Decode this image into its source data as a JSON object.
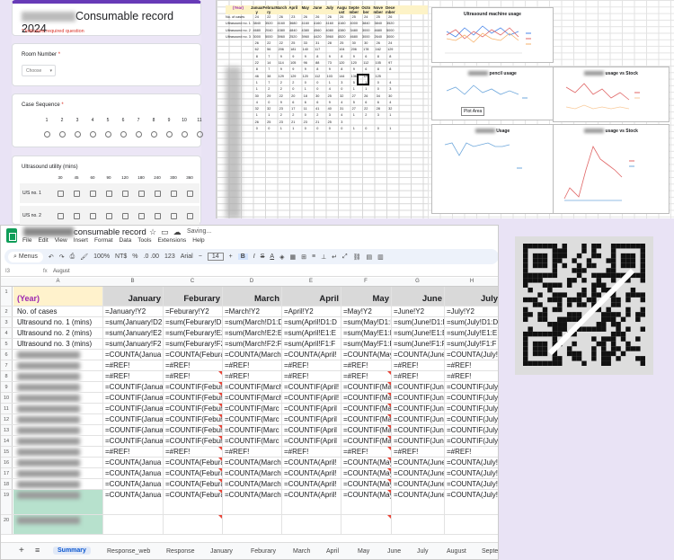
{
  "form": {
    "title_suffix": "Consumable record 2024",
    "required_note": "* Indicates required question",
    "room_label": "Room Number",
    "room_placeholder": "Choose",
    "case_label": "Case Sequence",
    "case_scale": [
      "1",
      "2",
      "3",
      "4",
      "5",
      "6",
      "7",
      "8",
      "9",
      "10",
      "11"
    ],
    "us_label": "Ultrasound utility (mins)",
    "us_columns": [
      "30",
      "45",
      "60",
      "90",
      "120",
      "180",
      "240",
      "300",
      "360"
    ],
    "us_rows": [
      "U/S no. 1",
      "U/S no. 2"
    ]
  },
  "mini_sheet": {
    "year": "(Year)",
    "months": [
      "Januar y",
      "Februa ry",
      "March",
      "April",
      "May",
      "June",
      "July",
      "Augu ust",
      "Septe mber",
      "Octo ber",
      "Nove mber",
      "Dece mber"
    ],
    "rows": [
      {
        "label": "No. of cases",
        "vals": [
          "24",
          "22",
          "26",
          "23",
          "26",
          "26",
          "26",
          "26",
          "25",
          "24",
          "25",
          "26"
        ]
      },
      {
        "label": "Ultrasound no. 1 (mins)",
        "vals": [
          "3840",
          "3520",
          "4160",
          "3680",
          "4160",
          "4160",
          "4160",
          "4160",
          "4000",
          "3840",
          "3840",
          "3520"
        ]
      },
      {
        "label": "Ultrasound no. 2 (mins)",
        "vals": [
          "4680",
          "2040",
          "4380",
          "4840",
          "4380",
          "4560",
          "4080",
          "4380",
          "3480",
          "3000",
          "4680",
          "5000"
        ]
      },
      {
        "label": "Ultrasound no. 3 (mins)",
        "vals": [
          "3000",
          "5000",
          "3960",
          "2520",
          "3960",
          "4420",
          "3960",
          "4520",
          "4680",
          "3000",
          "2640",
          "3000"
        ]
      },
      {
        "label": "",
        "vals": [
          "26",
          "22",
          "22",
          "25",
          "33",
          "31",
          "28",
          "25",
          "30",
          "30",
          "26",
          "24"
        ]
      },
      {
        "label": "",
        "vals": [
          "62",
          "56",
          "206",
          "181",
          "140",
          "117",
          "",
          "104",
          "206",
          "178",
          "162",
          "129"
        ]
      },
      {
        "label": "",
        "vals": [
          "8",
          "7",
          "9",
          "9",
          "9",
          "8",
          "9",
          "8",
          "9",
          "6",
          "8",
          "8"
        ]
      },
      {
        "label": "",
        "vals": [
          "22",
          "14",
          "114",
          "105",
          "96",
          "88",
          "73",
          "120",
          "120",
          "112",
          "105",
          "97"
        ]
      },
      {
        "label": "",
        "vals": [
          "8",
          "7",
          "9",
          "9",
          "9",
          "8",
          "9",
          "8",
          "9",
          "6",
          "8",
          "8"
        ]
      },
      {
        "label": "",
        "vals": [
          "46",
          "38",
          "129",
          "129",
          "120",
          "112",
          "103",
          "144",
          "136",
          "129",
          "125",
          ""
        ]
      },
      {
        "label": "",
        "vals": [
          "1",
          "7",
          "2",
          "2",
          "0",
          "0",
          "1",
          "3",
          "5",
          "1",
          "0",
          "4"
        ]
      },
      {
        "label": "",
        "vals": [
          "1",
          "2",
          "2",
          "0",
          "1",
          "0",
          "4",
          "0",
          "1",
          "1",
          "0",
          "3"
        ]
      },
      {
        "label": "",
        "vals": [
          "30",
          "29",
          "22",
          "20",
          "18",
          "30",
          "25",
          "32",
          "27",
          "26",
          "34",
          "30"
        ]
      },
      {
        "label": "",
        "vals": [
          "4",
          "0",
          "9",
          "6",
          "6",
          "6",
          "9",
          "4",
          "5",
          "6",
          "6",
          "4"
        ]
      },
      {
        "label": "",
        "vals": [
          "32",
          "32",
          "23",
          "17",
          "11",
          "41",
          "40",
          "31",
          "27",
          "22",
          "28",
          "32"
        ]
      },
      {
        "label": "",
        "vals": [
          "1",
          "1",
          "2",
          "2",
          "0",
          "2",
          "3",
          "4",
          "1",
          "2",
          "3",
          "1"
        ]
      },
      {
        "label": "",
        "vals": [
          "26",
          "25",
          "23",
          "21",
          "23",
          "21",
          "25",
          "3",
          "",
          "",
          "",
          ""
        ]
      },
      {
        "label": "",
        "vals": [
          "0",
          "0",
          "1",
          "1",
          "0",
          "0",
          "0",
          "0",
          "1",
          "0",
          "0",
          "1"
        ]
      }
    ]
  },
  "charts": [
    {
      "title": "Ultrasound machine usage",
      "legend": [
        "U/S no. 1",
        "U/S no. 2",
        "U/S no. 3"
      ]
    },
    {
      "title_suffix": "pencil usage",
      "legend": [
        "Radiant pencil usage"
      ],
      "overlay": "Plot Area"
    },
    {
      "title_suffix": "usage vs Stock",
      "legend": [
        "Radiant pencil usage",
        "Radiant pencil stock"
      ]
    },
    {
      "title_suffix": "Usage",
      "legend": [
        "PH Bair Bras Usage"
      ]
    },
    {
      "title_suffix": "usage vs Stock",
      "legend": [
        "PH Bair Bras Usage",
        "PH Bair Bras Stock"
      ]
    }
  ],
  "sheet": {
    "title_suffix": "consumable record",
    "saving": "Saving...",
    "menu": [
      "File",
      "Edit",
      "View",
      "Insert",
      "Format",
      "Data",
      "Tools",
      "Extensions",
      "Help"
    ],
    "search": "Menus",
    "zoom": "100%",
    "currency": "NT$",
    "percent": "%",
    "decimals": ".0  .00",
    "numfmt": "123",
    "font": "Arial",
    "font_size": "14",
    "cell_ref": "I3",
    "formula_value": "August",
    "col_letters": [
      "A",
      "B",
      "C",
      "D",
      "E",
      "F",
      "G",
      "H"
    ],
    "months": [
      "January",
      "Feburary",
      "March",
      "April",
      "May",
      "June",
      "July"
    ],
    "year": "(Year)",
    "rows": [
      {
        "n": "2",
        "label": "No. of cases",
        "vals": [
          "=January!Y2",
          "=Feburary!Y2",
          "=March!Y2",
          "=April!Y2",
          "=May!Y2",
          "=June!Y2",
          "=July!Y2"
        ]
      },
      {
        "n": "3",
        "label": "Ultrasound no. 1 (mins)",
        "vals": [
          "=sum(January!D2",
          "=sum(Feburary!D2",
          "=sum(March!D1:D",
          "=sum(April!D1:D",
          "=sum(May!D1:D",
          "=sum(June!D1:D",
          "=sum(July!D1:D"
        ]
      },
      {
        "n": "4",
        "label": "Ultrasound no. 2 (mins)",
        "vals": [
          "=sum(January!E2",
          "=sum(Feburary!E2",
          "=sum(March!E2:E",
          "=sum(April!E1:E",
          "=sum(May!E1:E",
          "=sum(June!E1:E",
          "=sum(July!E1:E"
        ]
      },
      {
        "n": "5",
        "label": "Ultrasound no. 3 (mins)",
        "vals": [
          "=sum(January!F2",
          "=sum(Feburary!F2",
          "=sum(March!F2:F",
          "=sum(April!F1:F",
          "=sum(May!F1:F",
          "=sum(June!F1:F",
          "=sum(July!F1:F"
        ]
      },
      {
        "n": "6",
        "label": "",
        "vals": [
          "=COUNTA(Janua",
          "=COUNTA(Febura",
          "=COUNTA(March",
          "=COUNTA(April!",
          "=COUNTA(May!",
          "=COUNTA(June",
          "=COUNTA(July!"
        ]
      },
      {
        "n": "7",
        "label": "",
        "vals": [
          "=#REF!",
          "=#REF!",
          "=#REF!",
          "=#REF!",
          "=#REF!",
          "=#REF!",
          "=#REF!"
        ]
      },
      {
        "n": "8",
        "label": "",
        "vals": [
          "=#REF!",
          "=#REF!",
          "=#REF!",
          "=#REF!",
          "=#REF!",
          "=#REF!",
          "=#REF!"
        ]
      },
      {
        "n": "9",
        "label": "",
        "vals": [
          "=COUNTIF(Janua",
          "=COUNTIF(Febur",
          "=COUNTIF(March",
          "=COUNTIF(April!",
          "=COUNTIF(May",
          "=COUNTIF(June",
          "=COUNTIF(July!"
        ]
      },
      {
        "n": "10",
        "label": "",
        "vals": [
          "=COUNTIF(Janua",
          "=COUNTIF(Febur",
          "=COUNTIF(March",
          "=COUNTIF(April!",
          "=COUNTIF(May",
          "=COUNTIF(June",
          "=COUNTIF(July!"
        ]
      },
      {
        "n": "11",
        "label": "",
        "vals": [
          "=COUNTIF(Janua",
          "=COUNTIF(Febur",
          "=COUNTIF(Marc",
          "=COUNTIF(April",
          "=COUNTIF(May",
          "=COUNTIF(Jun",
          "=COUNTIF(July"
        ]
      },
      {
        "n": "12",
        "label": "",
        "vals": [
          "=COUNTIF(Janua",
          "=COUNTIF(Febur",
          "=COUNTIF(Marc",
          "=COUNTIF(April",
          "=COUNTIF(May",
          "=COUNTIF(Jun",
          "=COUNTIF(July"
        ]
      },
      {
        "n": "13",
        "label": "",
        "vals": [
          "=COUNTIF(Janua",
          "=COUNTIF(Febur",
          "=COUNTIF(Marc",
          "=COUNTIF(April",
          "=COUNTIF(May",
          "=COUNTIF(Jun",
          "=COUNTIF(July"
        ]
      },
      {
        "n": "14",
        "label": "",
        "vals": [
          "=COUNTIF(Janua",
          "=COUNTIF(Febur",
          "=COUNTIF(Marc",
          "=COUNTIF(April",
          "=COUNTIF(May",
          "=COUNTIF(Jun",
          "=COUNTIF(July"
        ]
      },
      {
        "n": "15",
        "label": "",
        "vals": [
          "=#REF!",
          "=#REF!",
          "=#REF!",
          "=#REF!",
          "=#REF!",
          "=#REF!",
          "=#REF!"
        ]
      },
      {
        "n": "16",
        "label": "",
        "vals": [
          "=COUNTA(Janua",
          "=COUNTA(Febura",
          "=COUNTA(March",
          "=COUNTA(April!",
          "=COUNTA(May!",
          "=COUNTA(June",
          "=COUNTA(July!"
        ]
      },
      {
        "n": "17",
        "label": "",
        "vals": [
          "=COUNTA(Janua",
          "=COUNTA(Febura",
          "=COUNTA(March",
          "=COUNTA(April!",
          "=COUNTA(May!",
          "=COUNTA(June",
          "=COUNTA(July!"
        ]
      },
      {
        "n": "18",
        "label": "",
        "vals": [
          "=COUNTA(Janua",
          "=COUNTA(Febura",
          "=COUNTA(March",
          "=COUNTA(April!",
          "=COUNTA(May!",
          "=COUNTA(June",
          "=COUNTA(July!"
        ]
      },
      {
        "n": "19",
        "label": "",
        "vals": [
          "=COUNTA(Janua",
          "=COUNTA(Febura",
          "=COUNTA(March",
          "=COUNTA(April!",
          "=COUNTA(May!",
          "=COUNTA(June",
          "=COUNTA(July!"
        ]
      },
      {
        "n": "20",
        "label": "",
        "vals": [
          "",
          "",
          "",
          "",
          "",
          "",
          ""
        ]
      }
    ],
    "tabs": [
      "Summary",
      "Response_web",
      "Response",
      "January",
      "Feburary",
      "March",
      "April",
      "May",
      "June",
      "July",
      "August",
      "Septe"
    ]
  }
}
